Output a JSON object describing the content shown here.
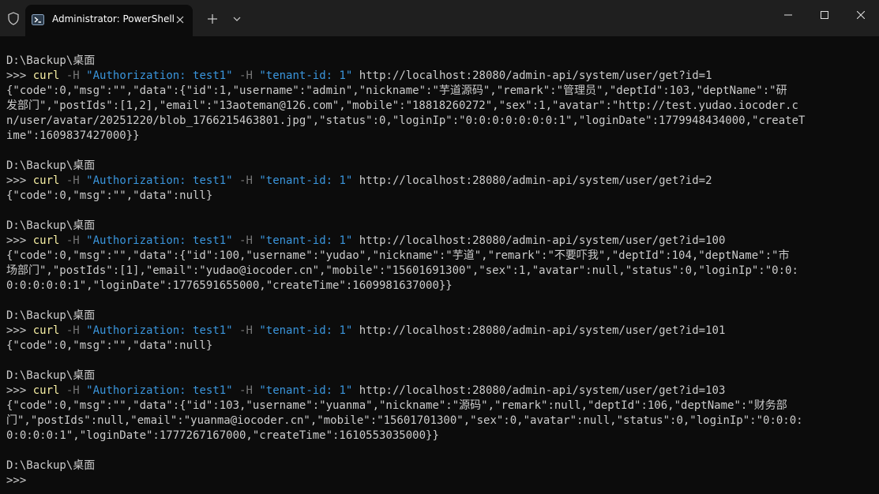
{
  "titlebar": {
    "tab_title": "Administrator: PowerShell",
    "new_tab_icon": "plus-icon",
    "dropdown_icon": "chevron-down-icon",
    "controls": [
      "minimize-icon",
      "maximize-icon",
      "close-icon"
    ]
  },
  "colors": {
    "background": "#0c0c0c",
    "titlebar": "#1f1f1f",
    "text": "#cccccc",
    "command": "#f9f1a5",
    "parameter": "#767676",
    "string": "#3a96dd"
  },
  "terminal": {
    "blocks": [
      {
        "dir": "D:\\Backup\\桌面",
        "prompt": ">>> ",
        "cmd": "curl",
        "flag1": "-H",
        "header1": "\"Authorization: test1\"",
        "flag2": "-H",
        "header2": "\"tenant-id: 1\"",
        "url": "http://localhost:28080/admin-api/system/user/get?id=1",
        "output": [
          "{\"code\":0,\"msg\":\"\",\"data\":{\"id\":1,\"username\":\"admin\",\"nickname\":\"芋道源码\",\"remark\":\"管理员\",\"deptId\":103,\"deptName\":\"研",
          "发部门\",\"postIds\":[1,2],\"email\":\"13aoteman@126.com\",\"mobile\":\"18818260272\",\"sex\":1,\"avatar\":\"http://test.yudao.iocoder.c",
          "n/user/avatar/20251220/blob_1766215463801.jpg\",\"status\":0,\"loginIp\":\"0:0:0:0:0:0:0:1\",\"loginDate\":1779948434000,\"createT",
          "ime\":1609837427000}}"
        ]
      },
      {
        "dir": "D:\\Backup\\桌面",
        "prompt": ">>> ",
        "cmd": "curl",
        "flag1": "-H",
        "header1": "\"Authorization: test1\"",
        "flag2": "-H",
        "header2": "\"tenant-id: 1\"",
        "url": "http://localhost:28080/admin-api/system/user/get?id=2",
        "output": [
          "{\"code\":0,\"msg\":\"\",\"data\":null}"
        ]
      },
      {
        "dir": "D:\\Backup\\桌面",
        "prompt": ">>> ",
        "cmd": "curl",
        "flag1": "-H",
        "header1": "\"Authorization: test1\"",
        "flag2": "-H",
        "header2": "\"tenant-id: 1\"",
        "url": "http://localhost:28080/admin-api/system/user/get?id=100",
        "output": [
          "{\"code\":0,\"msg\":\"\",\"data\":{\"id\":100,\"username\":\"yudao\",\"nickname\":\"芋道\",\"remark\":\"不要吓我\",\"deptId\":104,\"deptName\":\"市",
          "场部门\",\"postIds\":[1],\"email\":\"yudao@iocoder.cn\",\"mobile\":\"15601691300\",\"sex\":1,\"avatar\":null,\"status\":0,\"loginIp\":\"0:0:",
          "0:0:0:0:0:1\",\"loginDate\":1776591655000,\"createTime\":1609981637000}}"
        ]
      },
      {
        "dir": "D:\\Backup\\桌面",
        "prompt": ">>> ",
        "cmd": "curl",
        "flag1": "-H",
        "header1": "\"Authorization: test1\"",
        "flag2": "-H",
        "header2": "\"tenant-id: 1\"",
        "url": "http://localhost:28080/admin-api/system/user/get?id=101",
        "output": [
          "{\"code\":0,\"msg\":\"\",\"data\":null}"
        ]
      },
      {
        "dir": "D:\\Backup\\桌面",
        "prompt": ">>> ",
        "cmd": "curl",
        "flag1": "-H",
        "header1": "\"Authorization: test1\"",
        "flag2": "-H",
        "header2": "\"tenant-id: 1\"",
        "url": "http://localhost:28080/admin-api/system/user/get?id=103",
        "output": [
          "{\"code\":0,\"msg\":\"\",\"data\":{\"id\":103,\"username\":\"yuanma\",\"nickname\":\"源码\",\"remark\":null,\"deptId\":106,\"deptName\":\"财务部",
          "门\",\"postIds\":null,\"email\":\"yuanma@iocoder.cn\",\"mobile\":\"15601701300\",\"sex\":0,\"avatar\":null,\"status\":0,\"loginIp\":\"0:0:0:",
          "0:0:0:0:1\",\"loginDate\":1777267167000,\"createTime\":1610553035000}}"
        ]
      }
    ],
    "final_dir": "D:\\Backup\\桌面",
    "final_prompt": ">>>"
  }
}
